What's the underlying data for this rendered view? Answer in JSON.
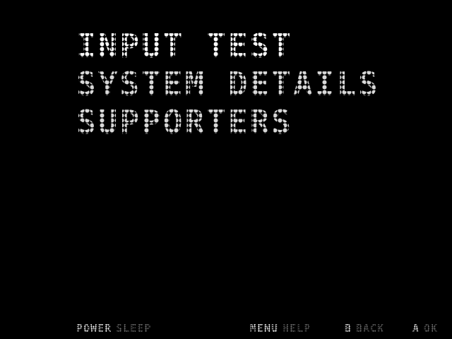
{
  "colors": {
    "background": "#000000",
    "menu_selected": "#ffffff",
    "menu_normal": "#d8d8d8",
    "hint_key": "#ffffff",
    "hint_action": "#6e6e6e"
  },
  "menu": {
    "items": [
      {
        "label": "INPUT TEST",
        "selected": true
      },
      {
        "label": "SYSTEM DETAILS",
        "selected": false
      },
      {
        "label": "SUPPORTERS",
        "selected": false
      }
    ]
  },
  "footer": {
    "hints": [
      {
        "key": "POWER",
        "action": "SLEEP"
      },
      {
        "key": "MENU",
        "action": "HELP"
      },
      {
        "key": "B",
        "action": "BACK"
      },
      {
        "key": "A",
        "action": "OK"
      }
    ]
  }
}
